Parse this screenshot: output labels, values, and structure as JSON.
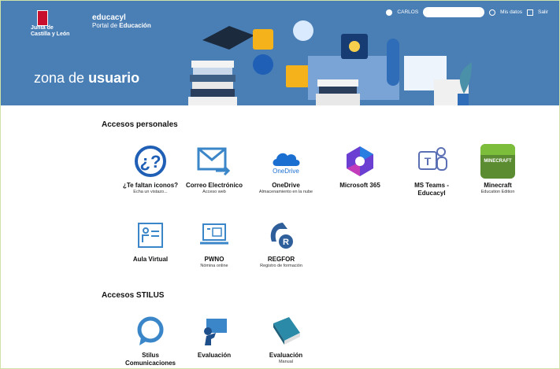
{
  "header": {
    "logo_lines": "Junta de\nCastilla y León",
    "brand": "educacyl",
    "portal_prefix": "Portal de ",
    "portal_bold": "Educación",
    "zone_prefix": "zona de ",
    "zone_bold": "usuario",
    "user": "CARLOS",
    "my_data": "Mis datos",
    "logout": "Salir"
  },
  "sections": {
    "personal": "Accesos personales",
    "stilus": "Accesos STILUS"
  },
  "apps": {
    "faltan": {
      "name": "¿Te faltan iconos?",
      "sub": "Echa un vistazo..."
    },
    "correo": {
      "name": "Correo Electrónico",
      "sub": "Acceso web"
    },
    "onedrive": {
      "name": "OneDrive",
      "sub": "Almacenamiento en la nube",
      "logo_text": "OneDrive"
    },
    "m365": {
      "name": "Microsoft 365"
    },
    "teams": {
      "name": "MS Teams - Educacyl"
    },
    "minecraft": {
      "name": "Minecraft",
      "sub": "Education Edition",
      "logo_text": "MINECRAFT"
    },
    "aula": {
      "name": "Aula Virtual"
    },
    "pwno": {
      "name": "PWNO",
      "sub": "Nómina online"
    },
    "regfor": {
      "name": "REGFOR",
      "sub": "Registro de formación"
    },
    "stilus_com": {
      "name": "Stilus Comunicaciones"
    },
    "evaluacion": {
      "name": "Evaluación"
    },
    "evaluacion_manual": {
      "name": "Evaluación",
      "sub": "Manual"
    }
  }
}
